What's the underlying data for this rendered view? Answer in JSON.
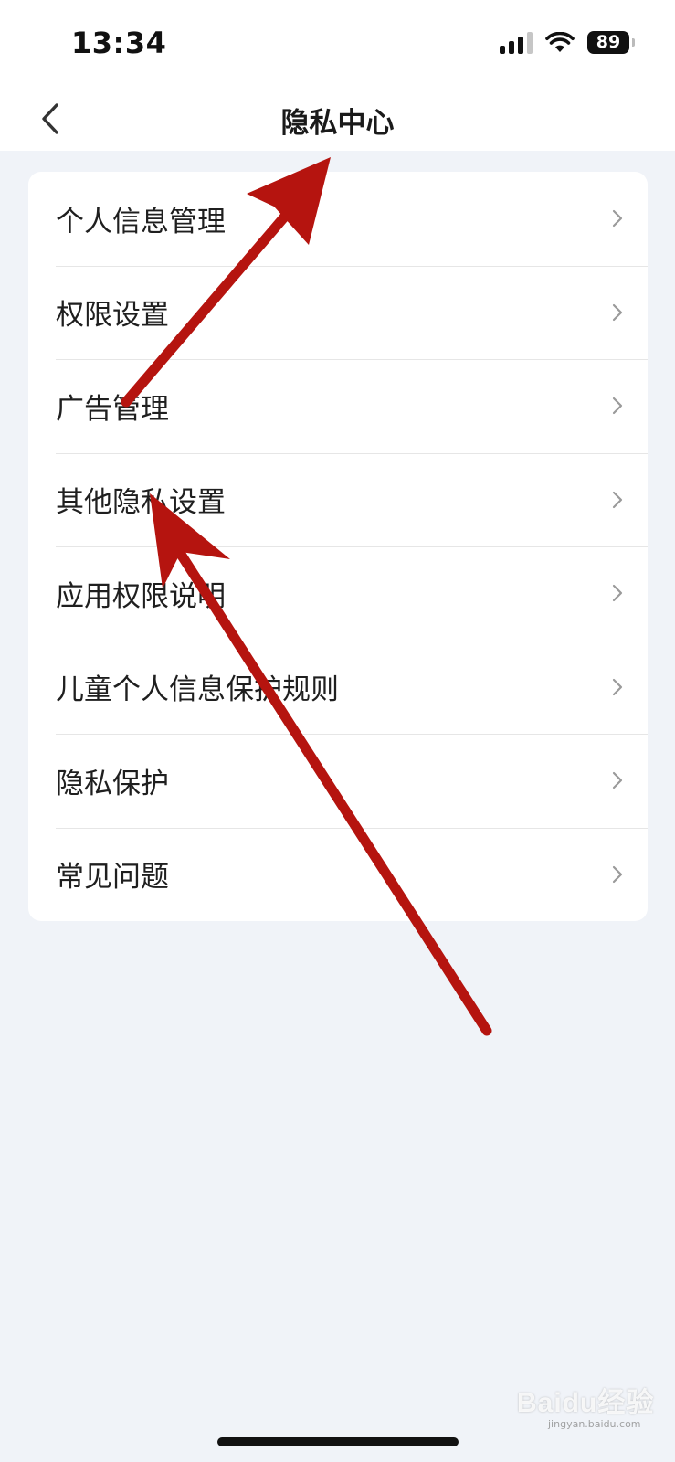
{
  "status_bar": {
    "time": "13:34",
    "battery": "89",
    "icons": [
      "signal-icon",
      "wifi-icon",
      "battery-icon"
    ]
  },
  "nav": {
    "title": "隐私中心",
    "back_icon": "chevron-left-icon"
  },
  "menu": {
    "items": [
      {
        "label": "个人信息管理"
      },
      {
        "label": "权限设置"
      },
      {
        "label": "广告管理"
      },
      {
        "label": "其他隐私设置"
      },
      {
        "label": "应用权限说明"
      },
      {
        "label": "儿童个人信息保护规则"
      },
      {
        "label": "隐私保护"
      },
      {
        "label": "常见问题"
      }
    ],
    "item_icon": "chevron-right-icon"
  },
  "annotations": {
    "arrow_color": "#b5140f"
  },
  "watermark": {
    "text": "Baidu经验",
    "sub": "jingyan.baidu.com"
  },
  "colors": {
    "background": "#f0f3f8",
    "card": "#ffffff",
    "divider": "#e6e6e6",
    "chevron": "#9a9a9a"
  }
}
